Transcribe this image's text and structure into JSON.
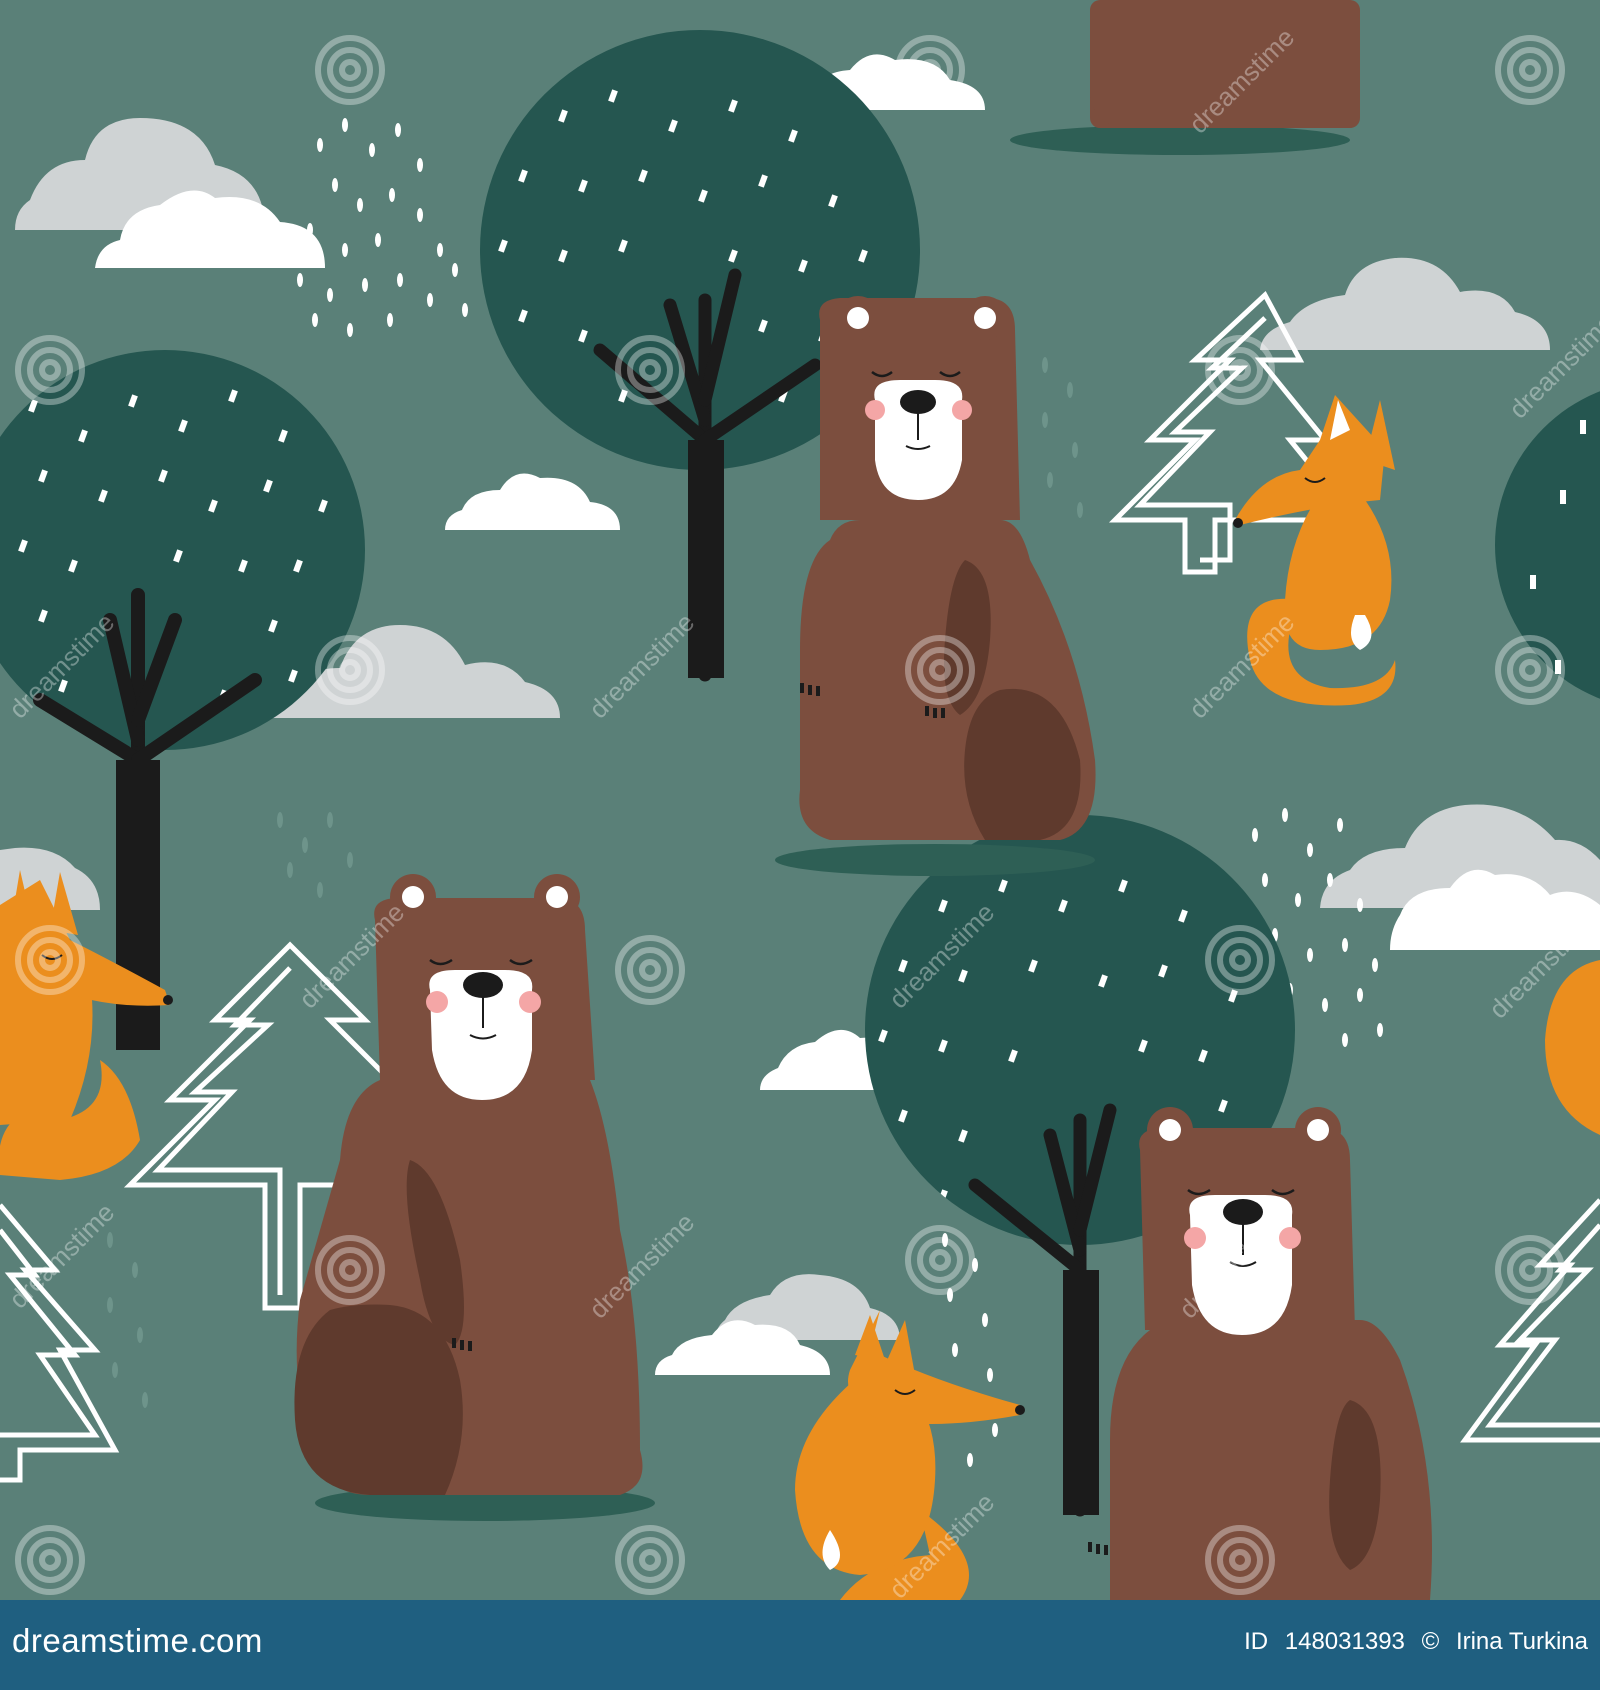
{
  "palette": {
    "background": "#5a8078",
    "tree_foliage": "#255650",
    "trunk": "#1b1b1b",
    "bear": "#7c4e3e",
    "bear_dark": "#5f3a2d",
    "fox": "#eb8e1e",
    "cloud_light": "#ffffff",
    "cloud_gray": "#cfd3d4",
    "footer": "#1f5f80"
  },
  "watermark_text": "dreamstime",
  "footer": {
    "site_name": "dreamstime.com",
    "id_label": "ID",
    "id_number": "148031393",
    "copyright_symbol": "©",
    "author": "Irina Turkina"
  }
}
